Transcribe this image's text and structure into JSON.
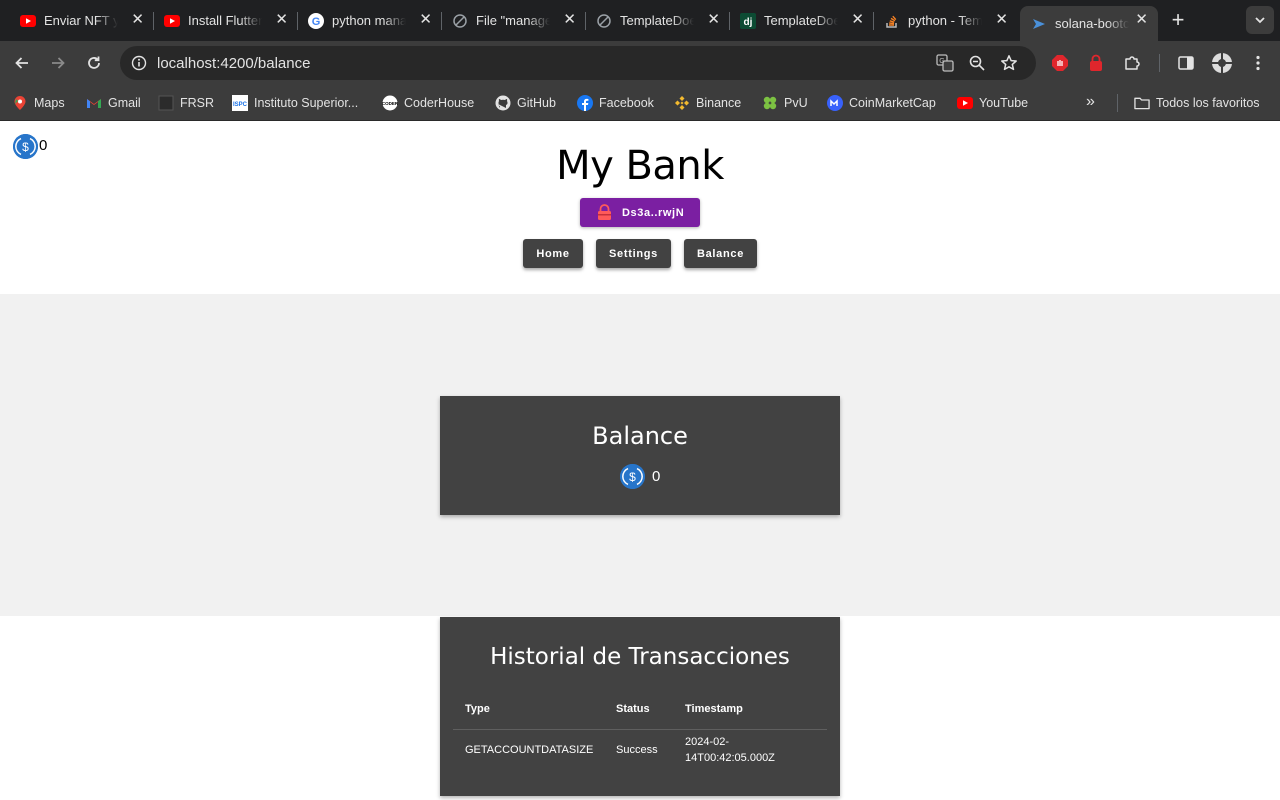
{
  "browser": {
    "tabs": [
      {
        "title": "Enviar NFT y",
        "icon": "youtube-icon"
      },
      {
        "title": "Install Flutter",
        "icon": "youtube-icon"
      },
      {
        "title": "python mana",
        "icon": "google-icon"
      },
      {
        "title": "File \"manage",
        "icon": "github-copilot-icon"
      },
      {
        "title": "TemplateDoe",
        "icon": "github-copilot-icon"
      },
      {
        "title": "TemplateDoe",
        "icon": "django-icon"
      },
      {
        "title": "python - Tem",
        "icon": "stackoverflow-icon"
      },
      {
        "title": "solana-bootc",
        "icon": "angular-icon",
        "active": true
      }
    ],
    "url": "localhost:4200/balance",
    "bookmarks": [
      {
        "label": "Maps",
        "icon": "google-maps-icon"
      },
      {
        "label": "Gmail",
        "icon": "gmail-icon"
      },
      {
        "label": "FRSR",
        "icon": "frsr-icon"
      },
      {
        "label": "Instituto Superior...",
        "icon": "ispc-icon"
      },
      {
        "label": "CoderHouse",
        "icon": "coderhouse-icon"
      },
      {
        "label": "GitHub",
        "icon": "github-icon"
      },
      {
        "label": "Facebook",
        "icon": "facebook-icon"
      },
      {
        "label": "Binance",
        "icon": "binance-icon"
      },
      {
        "label": "PvU",
        "icon": "pvu-icon"
      },
      {
        "label": "CoinMarketCap",
        "icon": "coinmarketcap-icon"
      },
      {
        "label": "YouTube",
        "icon": "youtube-icon"
      }
    ],
    "all_bookmarks_label": "Todos los favoritos"
  },
  "app": {
    "corner_balance": "0",
    "title": "My Bank",
    "wallet_label": "Ds3a..rwjN",
    "menu": {
      "home": "Home",
      "settings": "Settings",
      "balance": "Balance"
    },
    "balance_card": {
      "title": "Balance",
      "amount": "0"
    },
    "history": {
      "title": "Historial de Transacciones",
      "columns": [
        "Type",
        "Status",
        "Timestamp"
      ],
      "rows": [
        {
          "type": "GETACCOUNTDATASIZE",
          "status": "Success",
          "timestamp": "2024-02-14T00:42:05.000Z"
        }
      ]
    }
  },
  "colors": {
    "wallet_button": "#7b1fa2",
    "menu_button": "#424242",
    "card": "#424242",
    "usdc": "#2775ca"
  }
}
